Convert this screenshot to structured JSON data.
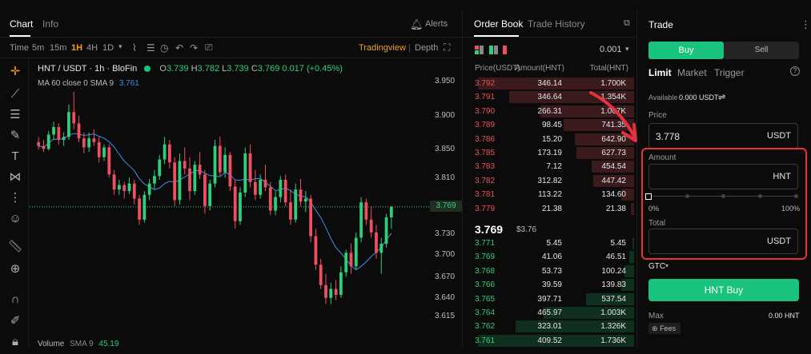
{
  "chart_tabs": {
    "chart": "Chart",
    "info": "Info",
    "alerts": "Alerts"
  },
  "toolbar": {
    "intervals": [
      "Time",
      "5m",
      "15m",
      "1H",
      "4H",
      "1D"
    ],
    "active_interval": "1H",
    "tradingview": "Tradingview",
    "depth": "Depth"
  },
  "legend": {
    "pair": "HNT / USDT · 1h · BloFin",
    "o_label": "O",
    "o": "3.739",
    "h_label": "H",
    "h": "3.782",
    "l_label": "L",
    "l": "3.739",
    "c_label": "C",
    "c": "3.769",
    "change": "0.017 (+0.45%)",
    "ma_label": "MA 60 close 0 SMA 9",
    "ma_value": "3.761",
    "volume_label": "Volume",
    "volume_sma": "SMA 9",
    "volume_value": "45.19"
  },
  "price_axis": {
    "ticks": [
      "3.950",
      "3.900",
      "3.850",
      "3.810",
      "3.769",
      "3.730",
      "3.700",
      "3.670",
      "3.640",
      "3.615"
    ],
    "current": "3.769"
  },
  "colors": {
    "up": "#2fce7a",
    "down": "#ef4f5f",
    "accent": "#19c37d",
    "ma": "#3c8ee8",
    "highlight": "#e5323c"
  },
  "orderbook": {
    "tab_book": "Order Book",
    "tab_history": "Trade History",
    "precision": "0.001",
    "col_price": "Price(USDT)",
    "col_amount": "Amount(HNT)",
    "col_total": "Total(HNT)",
    "asks": [
      {
        "price": "3.792",
        "amount": "346.14",
        "total": "1.700K",
        "depth": 1.0
      },
      {
        "price": "3.791",
        "amount": "346.64",
        "total": "1.354K",
        "depth": 0.8
      },
      {
        "price": "3.790",
        "amount": "266.31",
        "total": "1.007K",
        "depth": 0.6
      },
      {
        "price": "3.789",
        "amount": "98.45",
        "total": "741.35",
        "depth": 0.45
      },
      {
        "price": "3.786",
        "amount": "15.20",
        "total": "642.90",
        "depth": 0.38
      },
      {
        "price": "3.785",
        "amount": "173.19",
        "total": "627.73",
        "depth": 0.37
      },
      {
        "price": "3.783",
        "amount": "7.12",
        "total": "454.54",
        "depth": 0.27
      },
      {
        "price": "3.782",
        "amount": "312.82",
        "total": "447.42",
        "depth": 0.26
      },
      {
        "price": "3.781",
        "amount": "113.22",
        "total": "134.60",
        "depth": 0.08
      },
      {
        "price": "3.779",
        "amount": "21.38",
        "total": "21.38",
        "depth": 0.02
      }
    ],
    "mid_price": "3.769",
    "mid_usd": "$3.76",
    "bids": [
      {
        "price": "3.771",
        "amount": "5.45",
        "total": "5.45",
        "depth": 0.01
      },
      {
        "price": "3.769",
        "amount": "41.06",
        "total": "46.51",
        "depth": 0.03
      },
      {
        "price": "3.768",
        "amount": "53.73",
        "total": "100.24",
        "depth": 0.06
      },
      {
        "price": "3.766",
        "amount": "39.59",
        "total": "139.83",
        "depth": 0.08
      },
      {
        "price": "3.765",
        "amount": "397.71",
        "total": "537.54",
        "depth": 0.31
      },
      {
        "price": "3.764",
        "amount": "465.97",
        "total": "1.003K",
        "depth": 0.58
      },
      {
        "price": "3.762",
        "amount": "323.01",
        "total": "1.326K",
        "depth": 0.76
      },
      {
        "price": "3.761",
        "amount": "409.52",
        "total": "1.736K",
        "depth": 1.0
      }
    ]
  },
  "trade": {
    "title": "Trade",
    "buy": "Buy",
    "sell": "Sell",
    "order_types": [
      "Limit",
      "Market",
      "Trigger"
    ],
    "available_label": "Available",
    "available_value": "0.000 USDT",
    "price_label": "Price",
    "price_value": "3.778",
    "price_unit": "USDT",
    "amount_label": "Amount",
    "amount_unit": "HNT",
    "slider_min": "0%",
    "slider_max": "100%",
    "slider_level": 0,
    "total_label": "Total",
    "total_unit": "USDT",
    "tif": "GTC",
    "submit": "HNT Buy",
    "max_label": "Max",
    "max_value": "0.00 HNT",
    "fees": "Fees"
  },
  "chart_data": {
    "type": "candlestick",
    "ylim": [
      3.6,
      3.96
    ],
    "candles": [
      [
        3.855,
        3.862,
        3.845,
        3.85
      ],
      [
        3.85,
        3.858,
        3.842,
        3.846
      ],
      [
        3.846,
        3.87,
        3.844,
        3.865
      ],
      [
        3.865,
        3.882,
        3.858,
        3.875
      ],
      [
        3.875,
        3.88,
        3.852,
        3.858
      ],
      [
        3.858,
        3.868,
        3.85,
        3.862
      ],
      [
        3.862,
        3.905,
        3.858,
        3.895
      ],
      [
        3.895,
        3.922,
        3.872,
        3.88
      ],
      [
        3.88,
        3.89,
        3.855,
        3.86
      ],
      [
        3.86,
        3.868,
        3.84,
        3.848
      ],
      [
        3.848,
        3.868,
        3.842,
        3.86
      ],
      [
        3.86,
        3.872,
        3.85,
        3.855
      ],
      [
        3.855,
        3.862,
        3.828,
        3.835
      ],
      [
        3.835,
        3.852,
        3.83,
        3.848
      ],
      [
        3.848,
        3.852,
        3.808,
        3.812
      ],
      [
        3.812,
        3.818,
        3.785,
        3.792
      ],
      [
        3.792,
        3.805,
        3.785,
        3.798
      ],
      [
        3.798,
        3.802,
        3.78,
        3.79
      ],
      [
        3.79,
        3.808,
        3.786,
        3.8
      ],
      [
        3.8,
        3.805,
        3.772,
        3.78
      ],
      [
        3.78,
        3.785,
        3.745,
        3.752
      ],
      [
        3.752,
        3.79,
        3.748,
        3.785
      ],
      [
        3.785,
        3.806,
        3.778,
        3.8
      ],
      [
        3.8,
        3.818,
        3.792,
        3.81
      ],
      [
        3.81,
        3.838,
        3.805,
        3.832
      ],
      [
        3.832,
        3.862,
        3.826,
        3.852
      ],
      [
        3.852,
        3.858,
        3.82,
        3.828
      ],
      [
        3.828,
        3.835,
        3.77,
        3.778
      ],
      [
        3.778,
        3.84,
        3.772,
        3.83
      ],
      [
        3.83,
        3.848,
        3.812,
        3.82
      ],
      [
        3.82,
        3.835,
        3.778,
        3.79
      ],
      [
        3.79,
        3.83,
        3.785,
        3.825
      ],
      [
        3.825,
        3.842,
        3.806,
        3.812
      ],
      [
        3.812,
        3.818,
        3.76,
        3.77
      ],
      [
        3.77,
        3.805,
        3.764,
        3.8
      ],
      [
        3.8,
        3.858,
        3.795,
        3.85
      ],
      [
        3.85,
        3.862,
        3.81,
        3.815
      ],
      [
        3.815,
        3.848,
        3.808,
        3.838
      ],
      [
        3.838,
        3.842,
        3.79,
        3.796
      ],
      [
        3.796,
        3.805,
        3.74,
        3.75
      ],
      [
        3.75,
        3.795,
        3.745,
        3.788
      ],
      [
        3.788,
        3.848,
        3.782,
        3.84
      ],
      [
        3.84,
        3.852,
        3.795,
        3.802
      ],
      [
        3.802,
        3.818,
        3.778,
        3.785
      ],
      [
        3.785,
        3.812,
        3.78,
        3.805
      ],
      [
        3.805,
        3.825,
        3.79,
        3.795
      ],
      [
        3.795,
        3.802,
        3.758,
        3.764
      ],
      [
        3.764,
        3.79,
        3.758,
        3.782
      ],
      [
        3.782,
        3.81,
        3.775,
        3.805
      ],
      [
        3.805,
        3.812,
        3.77,
        3.775
      ],
      [
        3.775,
        3.792,
        3.745,
        3.752
      ],
      [
        3.752,
        3.8,
        3.748,
        3.792
      ],
      [
        3.792,
        3.806,
        3.77,
        3.776
      ],
      [
        3.776,
        3.79,
        3.762,
        3.78
      ],
      [
        3.78,
        3.785,
        3.722,
        3.73
      ],
      [
        3.73,
        3.74,
        3.685,
        3.692
      ],
      [
        3.692,
        3.7,
        3.66,
        3.665
      ],
      [
        3.665,
        3.68,
        3.64,
        3.648
      ],
      [
        3.648,
        3.668,
        3.64,
        3.66
      ],
      [
        3.66,
        3.672,
        3.645,
        3.652
      ],
      [
        3.652,
        3.69,
        3.648,
        3.682
      ],
      [
        3.682,
        3.712,
        3.676,
        3.708
      ],
      [
        3.708,
        3.72,
        3.68,
        3.69
      ],
      [
        3.69,
        3.735,
        3.685,
        3.728
      ],
      [
        3.728,
        3.782,
        3.722,
        3.775
      ],
      [
        3.775,
        3.78,
        3.745,
        3.752
      ],
      [
        3.752,
        3.77,
        3.728,
        3.735
      ],
      [
        3.735,
        3.745,
        3.7,
        3.708
      ],
      [
        3.708,
        3.728,
        3.68,
        3.72
      ],
      [
        3.72,
        3.76,
        3.715,
        3.755
      ],
      [
        3.755,
        3.77,
        3.74,
        3.769
      ]
    ]
  }
}
